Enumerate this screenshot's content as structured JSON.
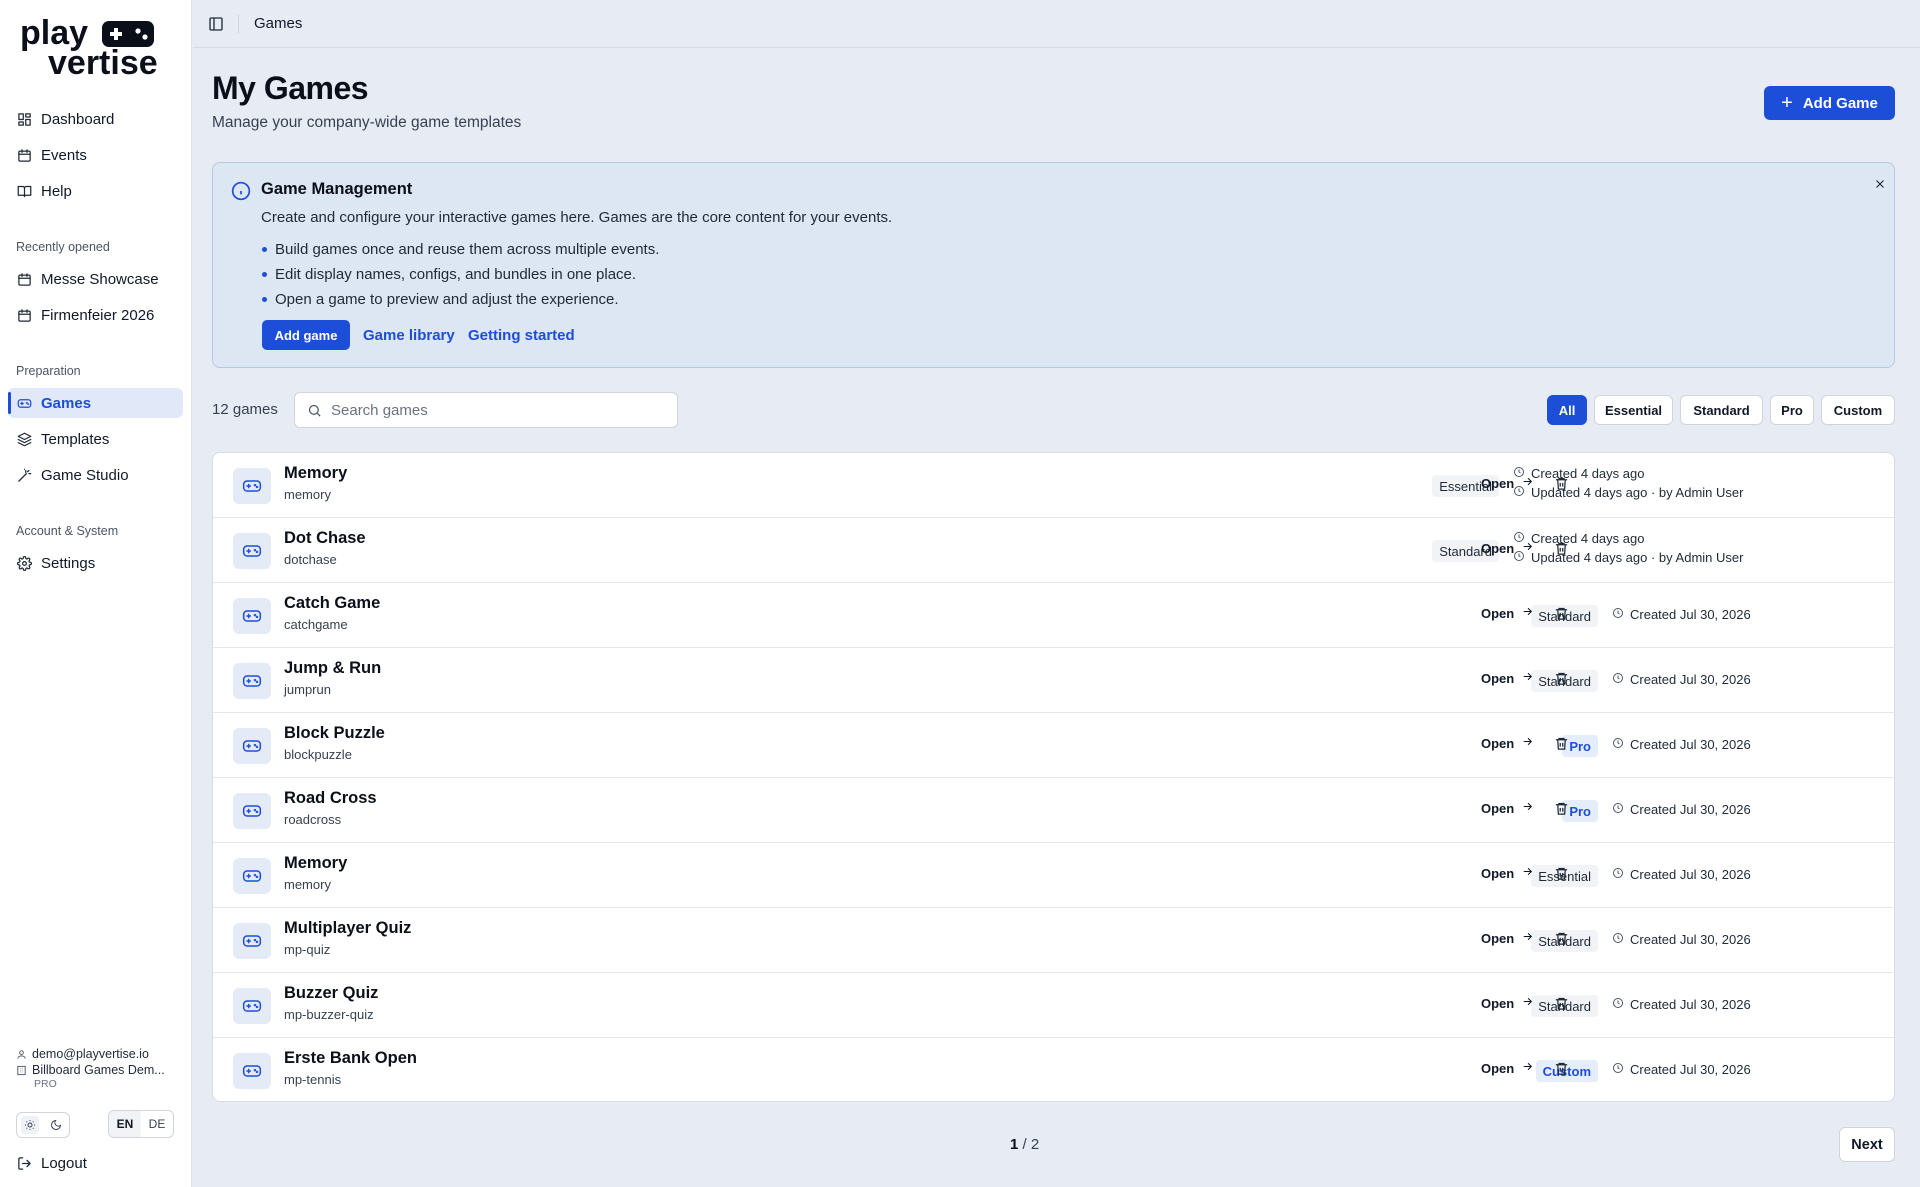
{
  "brand": {
    "line1": "play",
    "line2": "vertise"
  },
  "sidebar": {
    "main": [
      {
        "label": "Dashboard",
        "icon": "dashboard-icon"
      },
      {
        "label": "Events",
        "icon": "calendar-icon"
      },
      {
        "label": "Help",
        "icon": "book-icon"
      }
    ],
    "recent_label": "Recently opened",
    "recent": [
      {
        "label": "Messe Showcase",
        "icon": "calendar-icon"
      },
      {
        "label": "Firmenfeier 2026",
        "icon": "calendar-icon"
      }
    ],
    "prep_label": "Preparation",
    "prep": [
      {
        "label": "Games",
        "icon": "gamepad-icon",
        "active": true
      },
      {
        "label": "Templates",
        "icon": "layers-icon"
      },
      {
        "label": "Game Studio",
        "icon": "magic-wand-icon"
      }
    ],
    "account_label": "Account & System",
    "account": [
      {
        "label": "Settings",
        "icon": "gear-icon"
      }
    ],
    "user_email": "demo@playvertise.io",
    "company": "Billboard Games Dem...",
    "plan": "PRO",
    "lang_en": "EN",
    "lang_de": "DE",
    "logout": "Logout"
  },
  "topbar": {
    "breadcrumb": "Games"
  },
  "header": {
    "title": "My Games",
    "subtitle": "Manage your company-wide game templates",
    "add_button": "Add Game"
  },
  "info": {
    "title": "Game Management",
    "description": "Create and configure your interactive games here. Games are the core content for your events.",
    "bullets": [
      "Build games once and reuse them across multiple events.",
      "Edit display names, configs, and bundles in one place.",
      "Open a game to preview and adjust the experience."
    ],
    "add_button": "Add game",
    "link_library": "Game library",
    "link_started": "Getting started"
  },
  "toolbar": {
    "count": "12 games",
    "search_placeholder": "Search games",
    "filters": [
      "All",
      "Essential",
      "Standard",
      "Pro",
      "Custom"
    ],
    "active_filter": "All"
  },
  "games": [
    {
      "name": "Memory",
      "slug": "memory",
      "tier": "Essential",
      "created": "Created 4 days ago",
      "updated": "Updated 4 days ago · by Admin User"
    },
    {
      "name": "Dot Chase",
      "slug": "dotchase",
      "tier": "Standard",
      "created": "Created 4 days ago",
      "updated": "Updated 4 days ago · by Admin User"
    },
    {
      "name": "Catch Game",
      "slug": "catchgame",
      "tier": "Standard",
      "created": "Created Jul 30, 2026"
    },
    {
      "name": "Jump & Run",
      "slug": "jumprun",
      "tier": "Standard",
      "created": "Created Jul 30, 2026"
    },
    {
      "name": "Block Puzzle",
      "slug": "blockpuzzle",
      "tier": "Pro",
      "created": "Created Jul 30, 2026"
    },
    {
      "name": "Road Cross",
      "slug": "roadcross",
      "tier": "Pro",
      "created": "Created Jul 30, 2026"
    },
    {
      "name": "Memory",
      "slug": "memory",
      "tier": "Essential",
      "created": "Created Jul 30, 2026"
    },
    {
      "name": "Multiplayer Quiz",
      "slug": "mp-quiz",
      "tier": "Standard",
      "created": "Created Jul 30, 2026"
    },
    {
      "name": "Buzzer Quiz",
      "slug": "mp-buzzer-quiz",
      "tier": "Standard",
      "created": "Created Jul 30, 2026"
    },
    {
      "name": "Erste Bank Open",
      "slug": "mp-tennis",
      "tier": "Custom",
      "created": "Created Jul 30, 2026"
    }
  ],
  "row_actions": {
    "open": "Open"
  },
  "pagination": {
    "current": "1",
    "total": "2",
    "next": "Next"
  },
  "colors": {
    "accent": "#1d4ed8",
    "background": "#e7ebf3",
    "info_bg": "#dde6f3"
  }
}
